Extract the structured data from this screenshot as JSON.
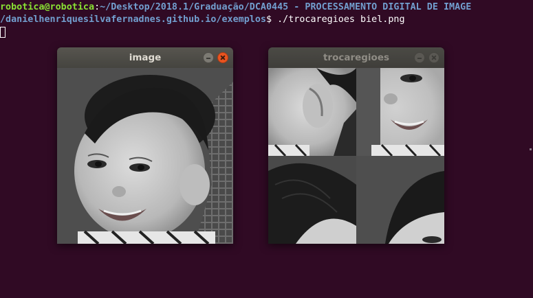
{
  "terminal": {
    "user_host": "robotica@robotica",
    "separator": ":",
    "path_part1": "~/Desktop/2018.1/Graduação/DCA0445 - PROCESSAMENTO DIGITAL DE IMAGE",
    "path_part2": "/danielhenriquesilvafernadnes.github.io/exemplos",
    "prompt_symbol": "$",
    "command": " ./trocaregioes biel.png"
  },
  "windows": {
    "image": {
      "title": "image",
      "image_description": "grayscale photo of smiling baby"
    },
    "trocaregioes": {
      "title": "trocaregioes",
      "image_description": "grayscale photo of baby with quadrants swapped"
    }
  },
  "icons": {
    "minimize": "minimize-icon",
    "close": "close-icon"
  },
  "colors": {
    "terminal_bg": "#300a24",
    "prompt_user": "#8ae234",
    "prompt_path": "#729fcf",
    "close_active": "#e95420"
  }
}
